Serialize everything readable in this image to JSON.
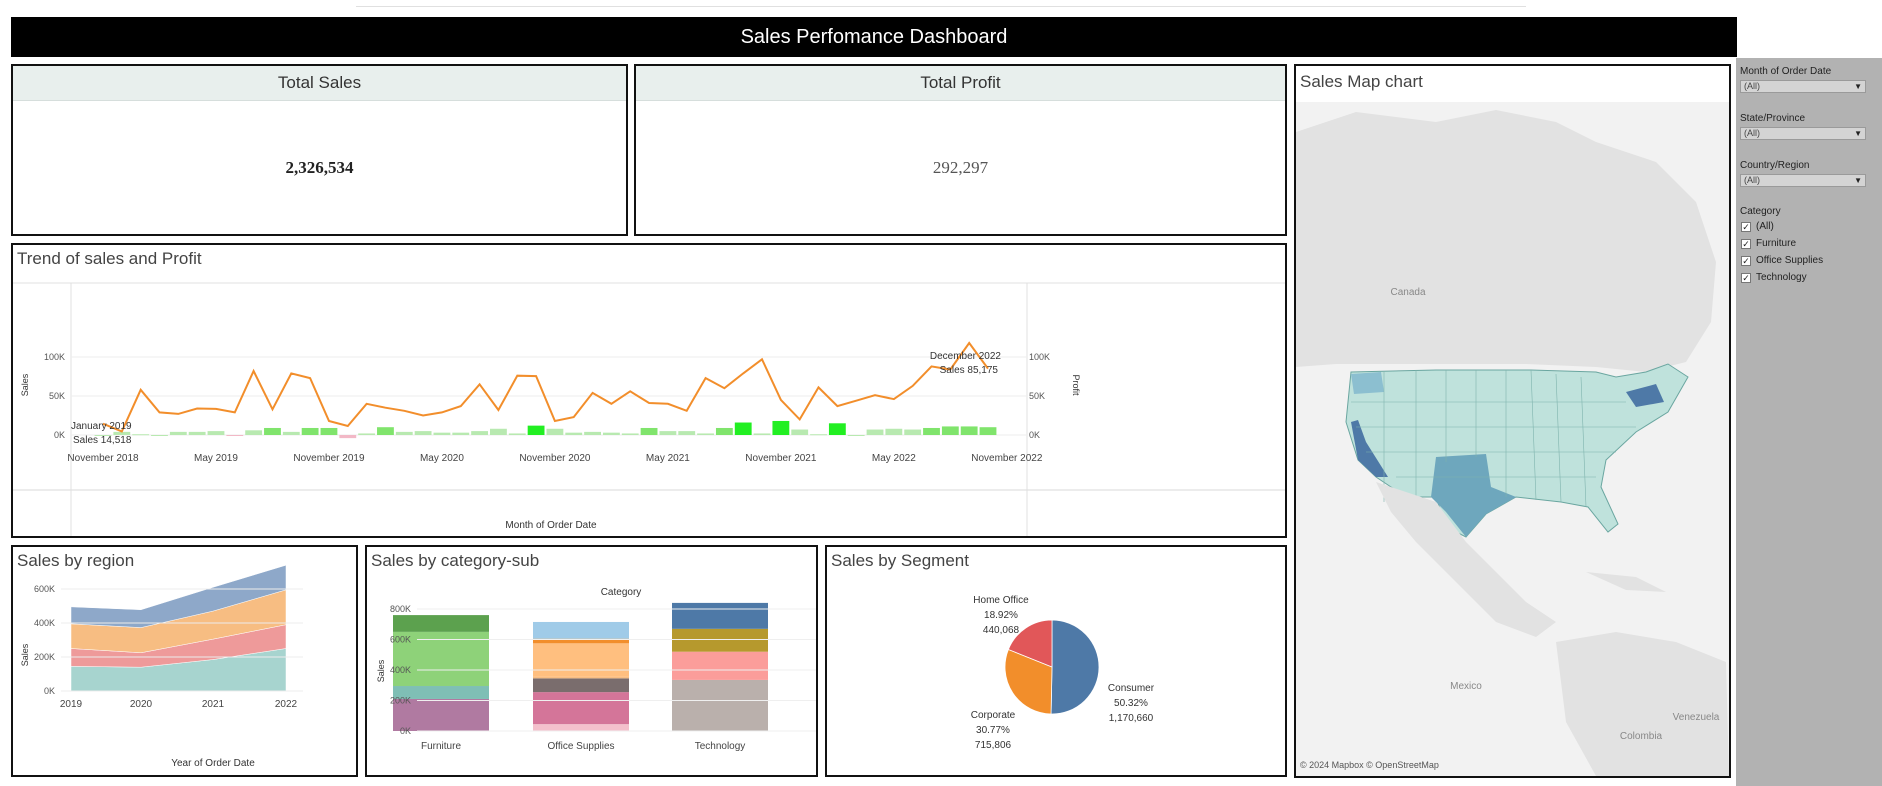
{
  "header": {
    "title": "Sales Perfomance Dashboard"
  },
  "kpis": {
    "total_sales": {
      "label": "Total Sales",
      "value": "2,326,534"
    },
    "total_profit": {
      "label": "Total Profit",
      "value": "292,297"
    }
  },
  "trend": {
    "title": "Trend of sales and Profit",
    "chart_data": {
      "type": "line",
      "x_label": "Month of Order Date",
      "y_label_left": "Sales",
      "y_label_right": "Profit",
      "y_ticks_left": [
        "100K",
        "50K",
        "0K"
      ],
      "y_ticks_right": [
        "100K",
        "50K",
        "0K"
      ],
      "x_ticks": [
        "November 2018",
        "May 2019",
        "November 2019",
        "May 2020",
        "November 2020",
        "May 2021",
        "November 2021",
        "May 2022",
        "November 2022"
      ],
      "sales": [
        14518,
        4500,
        58000,
        29000,
        27000,
        34000,
        33500,
        29000,
        82000,
        33000,
        79000,
        73000,
        18000,
        11500,
        40000,
        35000,
        31000,
        25000,
        29000,
        37000,
        65000,
        32000,
        76000,
        75500,
        18000,
        23000,
        54000,
        40000,
        56000,
        41000,
        40000,
        31000,
        73000,
        60000,
        79000,
        97000,
        45000,
        20000,
        61000,
        37000,
        44000,
        51000,
        46000,
        63000,
        88000,
        84000,
        118000,
        85175
      ],
      "profit": [
        0,
        4000,
        1000,
        0,
        4000,
        4000,
        5000,
        -1000,
        6000,
        9000,
        4000,
        9000,
        9000,
        -4000,
        2000,
        10000,
        4000,
        5000,
        3000,
        3000,
        5000,
        8000,
        2000,
        12000,
        8000,
        3000,
        4000,
        3000,
        2000,
        9000,
        5000,
        5000,
        2000,
        9000,
        16000,
        2000,
        18000,
        7000,
        1000,
        15000,
        0,
        7000,
        8000,
        7000,
        9000,
        11000,
        11000,
        10000
      ],
      "annotations": [
        {
          "line1": "January 2019",
          "line2": "Sales 14,518"
        },
        {
          "line1": "December 2022",
          "line2": "Sales 85,175"
        }
      ]
    }
  },
  "region": {
    "title": "Sales by region",
    "chart_data": {
      "type": "area",
      "x": [
        "2019",
        "2020",
        "2021",
        "2022"
      ],
      "x_label": "Year of Order Date",
      "y_label": "Sales",
      "y_ticks": [
        "600K",
        "400K",
        "200K",
        "0K"
      ],
      "series": [
        {
          "color": "#a7d4cf",
          "values": [
            145000,
            140000,
            185000,
            250000
          ]
        },
        {
          "color": "#ee9a9a",
          "values": [
            105000,
            85000,
            120000,
            140000
          ]
        },
        {
          "color": "#f7bd82",
          "values": [
            145000,
            148000,
            165000,
            205000
          ]
        },
        {
          "color": "#8ea8c9",
          "values": [
            100000,
            105000,
            140000,
            145000
          ]
        }
      ]
    }
  },
  "category": {
    "title": "Sales by category-sub",
    "chart_data": {
      "type": "bar",
      "legend_title": "Category",
      "y_label": "Sales",
      "y_ticks": [
        "800K",
        "600K",
        "400K",
        "200K",
        "0K"
      ],
      "categories": [
        "Furniture",
        "Office Supplies",
        "Technology"
      ],
      "stacks": [
        [
          {
            "color": "#b07aa1",
            "value": 210000
          },
          {
            "color": "#7fbfb5",
            "value": 85000
          },
          {
            "color": "#8ed279",
            "value": 355000
          },
          {
            "color": "#5ca14e",
            "value": 110000
          }
        ],
        [
          {
            "color": "#f4c0cc",
            "value": 45000
          },
          {
            "color": "#d47599",
            "value": 210000
          },
          {
            "color": "#7a6d6d",
            "value": 90000
          },
          {
            "color": "#f7bd82",
            "value": 10000
          },
          {
            "color": "#ffbf7f",
            "value": 220000
          },
          {
            "color": "#f28e2b",
            "value": 30000
          },
          {
            "color": "#a0cbe8",
            "value": 110000
          }
        ],
        [
          {
            "color": "#bab0ac",
            "value": 335000
          },
          {
            "color": "#fb9d9a",
            "value": 185000
          },
          {
            "color": "#b6992d",
            "value": 150000
          },
          {
            "color": "#4e79a7",
            "value": 170000
          }
        ]
      ]
    }
  },
  "segment": {
    "title": "Sales by Segment",
    "chart_data": {
      "type": "pie",
      "slices": [
        {
          "name": "Consumer",
          "percent": "50.32%",
          "value": "1,170,660",
          "share": 0.5032,
          "color": "#4e79a7"
        },
        {
          "name": "Corporate",
          "percent": "30.77%",
          "value": "715,806",
          "share": 0.3077,
          "color": "#f28e2b"
        },
        {
          "name": "Home Office",
          "percent": "18.92%",
          "value": "440,068",
          "share": 0.1892,
          "color": "#e15759"
        }
      ]
    }
  },
  "map": {
    "title": "Sales Map chart",
    "labels": {
      "canada": "Canada",
      "mexico": "Mexico",
      "colombia": "Colombia",
      "venezuela": "Venezuela"
    },
    "attribution": "© 2024 Mapbox © OpenStreetMap"
  },
  "filters": {
    "month": {
      "label": "Month of Order Date",
      "value": "(All)"
    },
    "state": {
      "label": "State/Province",
      "value": "(All)"
    },
    "country": {
      "label": "Country/Region",
      "value": "(All)"
    },
    "category": {
      "label": "Category",
      "options": [
        "(All)",
        "Furniture",
        "Office Supplies",
        "Technology"
      ]
    }
  }
}
